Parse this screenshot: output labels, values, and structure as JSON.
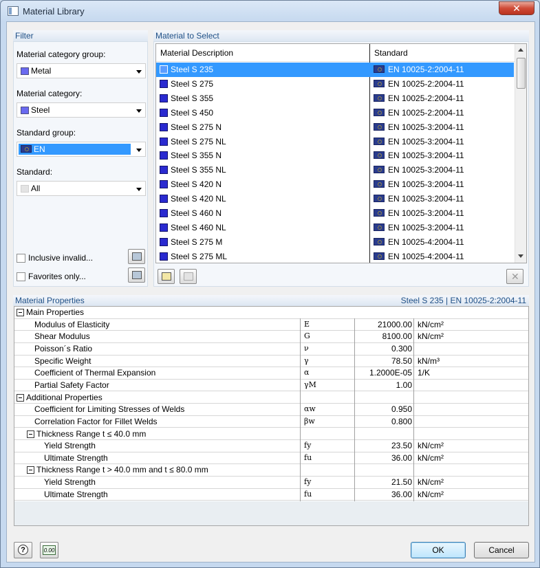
{
  "window": {
    "title": "Material Library",
    "close_glyph": "✕"
  },
  "filter": {
    "heading": "Filter",
    "category_group_label": "Material category group:",
    "category_group_value": "Metal",
    "category_label": "Material category:",
    "category_value": "Steel",
    "standard_group_label": "Standard group:",
    "standard_group_value": "EN",
    "standard_label": "Standard:",
    "standard_value": "All",
    "inclusive_invalid_label": "Inclusive invalid...",
    "favorites_only_label": "Favorites only..."
  },
  "materials": {
    "heading": "Material to Select",
    "col_description": "Material Description",
    "col_standard": "Standard",
    "rows": [
      {
        "name": "Steel S 235",
        "standard": "EN 10025-2:2004-11"
      },
      {
        "name": "Steel S 275",
        "standard": "EN 10025-2:2004-11"
      },
      {
        "name": "Steel S 355",
        "standard": "EN 10025-2:2004-11"
      },
      {
        "name": "Steel S 450",
        "standard": "EN 10025-2:2004-11"
      },
      {
        "name": "Steel S 275 N",
        "standard": "EN 10025-3:2004-11"
      },
      {
        "name": "Steel S 275 NL",
        "standard": "EN 10025-3:2004-11"
      },
      {
        "name": "Steel S 355 N",
        "standard": "EN 10025-3:2004-11"
      },
      {
        "name": "Steel S 355 NL",
        "standard": "EN 10025-3:2004-11"
      },
      {
        "name": "Steel S 420 N",
        "standard": "EN 10025-3:2004-11"
      },
      {
        "name": "Steel S 420 NL",
        "standard": "EN 10025-3:2004-11"
      },
      {
        "name": "Steel S 460 N",
        "standard": "EN 10025-3:2004-11"
      },
      {
        "name": "Steel S 460 NL",
        "standard": "EN 10025-3:2004-11"
      },
      {
        "name": "Steel S 275 M",
        "standard": "EN 10025-4:2004-11"
      },
      {
        "name": "Steel S 275 ML",
        "standard": "EN 10025-4:2004-11"
      }
    ]
  },
  "properties": {
    "heading": "Material Properties",
    "selected_info": "Steel S 235  |  EN 10025-2:2004-11",
    "rows": [
      {
        "kind": "group",
        "level": 0,
        "name": "Main Properties"
      },
      {
        "kind": "item",
        "level": 1,
        "name": "Modulus of Elasticity",
        "symbol": "E",
        "value": "21000.00",
        "unit": "kN/cm²"
      },
      {
        "kind": "item",
        "level": 1,
        "name": "Shear Modulus",
        "symbol": "G",
        "value": "8100.00",
        "unit": "kN/cm²"
      },
      {
        "kind": "item",
        "level": 1,
        "name": "Poisson´s Ratio",
        "symbol": "ν",
        "value": "0.300",
        "unit": ""
      },
      {
        "kind": "item",
        "level": 1,
        "name": "Specific Weight",
        "symbol": "γ",
        "value": "78.50",
        "unit": "kN/m³"
      },
      {
        "kind": "item",
        "level": 1,
        "name": "Coefficient of Thermal Expansion",
        "symbol": "α",
        "value": "1.2000E-05",
        "unit": "1/K"
      },
      {
        "kind": "item",
        "level": 1,
        "name": "Partial Safety Factor",
        "symbol": "γM",
        "value": "1.00",
        "unit": ""
      },
      {
        "kind": "group",
        "level": 0,
        "name": "Additional Properties"
      },
      {
        "kind": "item",
        "level": 1,
        "name": "Coefficient for Limiting Stresses of Welds",
        "symbol": "αw",
        "value": "0.950",
        "unit": ""
      },
      {
        "kind": "item",
        "level": 1,
        "name": "Correlation Factor for Fillet Welds",
        "symbol": "βw",
        "value": "0.800",
        "unit": ""
      },
      {
        "kind": "group",
        "level": 1,
        "name": "Thickness Range t ≤ 40.0 mm"
      },
      {
        "kind": "item",
        "level": 2,
        "name": "Yield Strength",
        "symbol": "fy",
        "value": "23.50",
        "unit": "kN/cm²"
      },
      {
        "kind": "item",
        "level": 2,
        "name": "Ultimate Strength",
        "symbol": "fu",
        "value": "36.00",
        "unit": "kN/cm²"
      },
      {
        "kind": "group",
        "level": 1,
        "name": "Thickness Range t > 40.0 mm and t ≤ 80.0 mm"
      },
      {
        "kind": "item",
        "level": 2,
        "name": "Yield Strength",
        "symbol": "fy",
        "value": "21.50",
        "unit": "kN/cm²"
      },
      {
        "kind": "item",
        "level": 2,
        "name": "Ultimate Strength",
        "symbol": "fu",
        "value": "36.00",
        "unit": "kN/cm²"
      }
    ]
  },
  "footer": {
    "ok_label": "OK",
    "cancel_label": "Cancel",
    "help_glyph": "?",
    "units_glyph": "0.00"
  },
  "icons": {
    "app": "window-icon",
    "help": "help-icon",
    "units": "decimal-places-icon",
    "new_material": "new-material-icon",
    "edit_material": "edit-material-icon",
    "delete": "delete-icon",
    "filter_settings": "filter-settings-icon"
  },
  "colors": {
    "selection": "#3399ff",
    "heading_text": "#1e4f86",
    "material_swatch": "#2a2ad0"
  }
}
